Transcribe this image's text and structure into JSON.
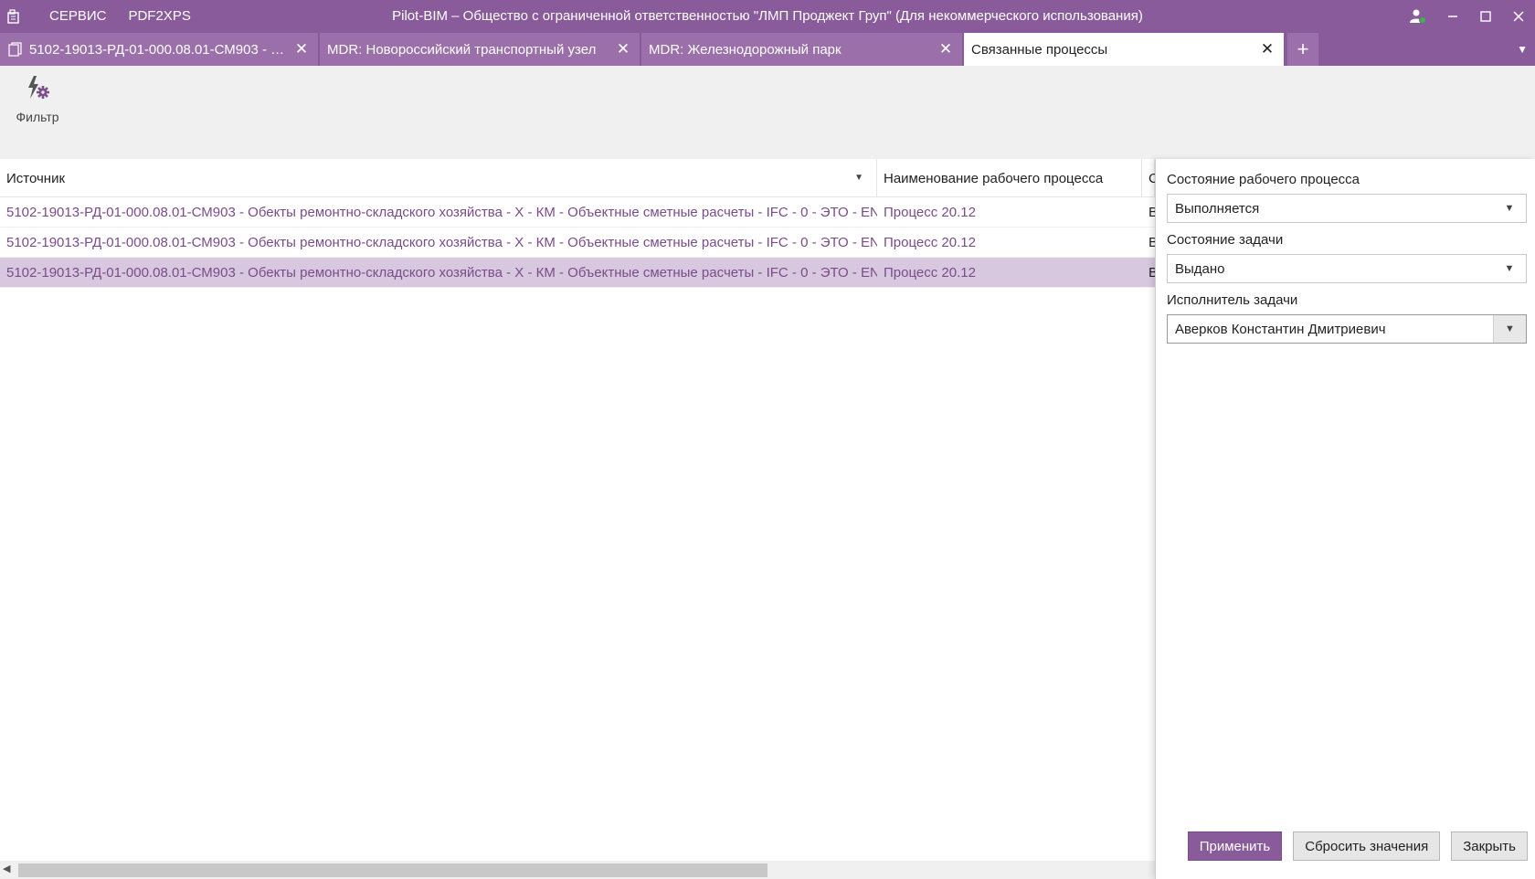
{
  "titlebar": {
    "menu": [
      "СЕРВИС",
      "PDF2XPS"
    ],
    "title": "Pilot-BIM – Общество с ограниченной ответственностью \"ЛМП Проджект Груп\" (Для некоммерческого использования)",
    "icons": [
      "app-icon",
      "user-online-icon",
      "minimize-icon",
      "maximize-icon",
      "close-icon"
    ]
  },
  "tabs": [
    {
      "label": "5102-19013-РД-01-000.08.01-СМ903 - О...",
      "icon": "document-icon",
      "active": false
    },
    {
      "label": "MDR: Новороссийский транспортный узел",
      "active": false
    },
    {
      "label": "MDR: Железнодорожный парк",
      "active": false
    },
    {
      "label": "Связанные процессы",
      "active": true
    }
  ],
  "toolbar": {
    "filter_label": "Фильтр"
  },
  "grid": {
    "columns": [
      "Источник",
      "Наименование рабочего процесса",
      "С"
    ],
    "rows": [
      {
        "source": "5102-19013-РД-01-000.08.01-СМ903 - Обекты ремонтно-складского хозяйства - Х - КМ - Объектные сметные расчеты - IFC - 0 - ЭТО - EN",
        "name": "Процесс 20.12",
        "state": "В",
        "selected": false
      },
      {
        "source": "5102-19013-РД-01-000.08.01-СМ903 - Обекты ремонтно-складского хозяйства - Х - КМ - Объектные сметные расчеты - IFC - 0 - ЭТО - EN",
        "name": "Процесс 20.12",
        "state": "В",
        "selected": false
      },
      {
        "source": "5102-19013-РД-01-000.08.01-СМ903 - Обекты ремонтно-складского хозяйства - Х - КМ - Объектные сметные расчеты - IFC - 0 - ЭТО - EN",
        "name": "Процесс 20.12",
        "state": "В",
        "selected": true
      }
    ]
  },
  "filter_panel": {
    "workflow_state_label": "Состояние рабочего процесса",
    "workflow_state_value": "Выполняется",
    "task_state_label": "Состояние задачи",
    "task_state_value": "Выдано",
    "task_executor_label": "Исполнитель задачи",
    "task_executor_value": "Аверков Константин Дмитриевич",
    "apply_label": "Применить",
    "reset_label": "Сбросить значения",
    "close_label": "Закрыть"
  },
  "colors": {
    "accent": "#8a5b9a",
    "link": "#7a4c8a",
    "selected_row": "#d8c8df"
  }
}
